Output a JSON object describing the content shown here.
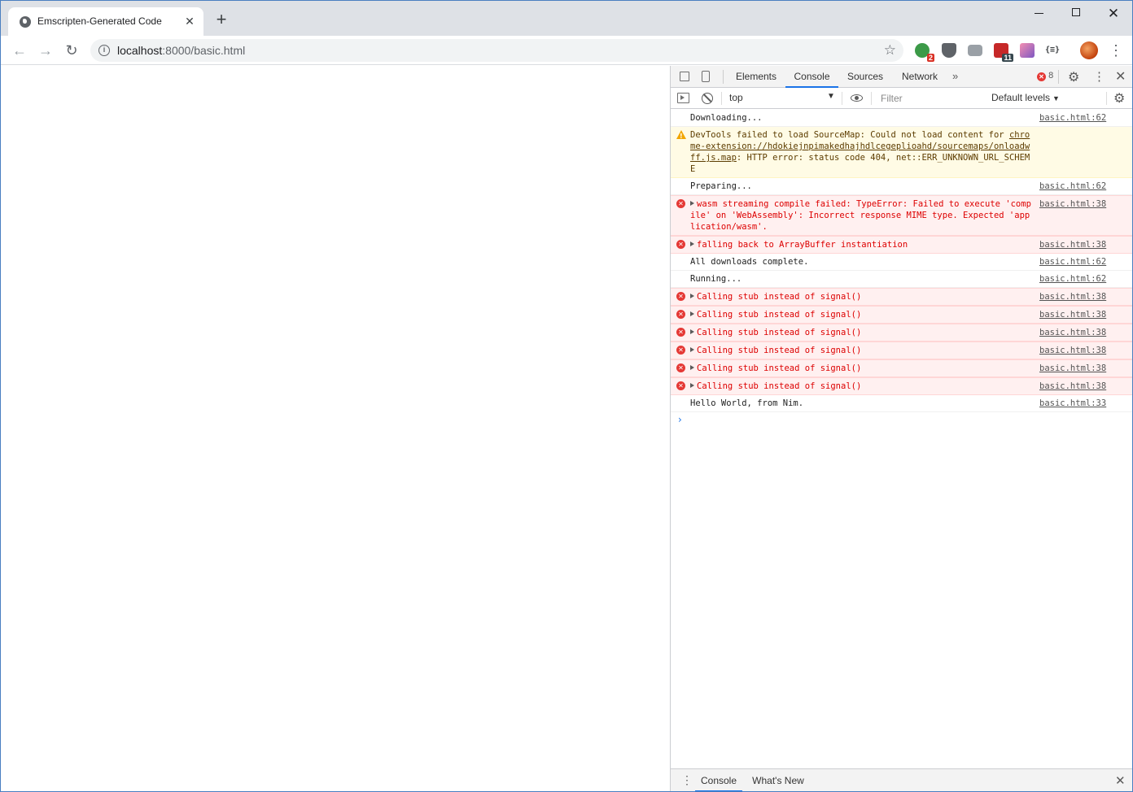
{
  "browser": {
    "tab_title": "Emscripten-Generated Code",
    "tab_close": "✕",
    "new_tab": "+",
    "url_host": "localhost",
    "url_path": ":8000/basic.html",
    "extensions": [
      {
        "name": "ext-green",
        "badge": "2"
      },
      {
        "name": "ext-shield",
        "badge": ""
      },
      {
        "name": "ext-camera",
        "badge": ""
      },
      {
        "name": "ext-calendar",
        "badge": "11"
      },
      {
        "name": "ext-gradient",
        "badge": ""
      },
      {
        "name": "ext-json",
        "label": "{≡}"
      }
    ]
  },
  "devtools": {
    "tabs": [
      "Elements",
      "Console",
      "Sources",
      "Network"
    ],
    "active_tab": "Console",
    "more": "»",
    "error_count": "8",
    "context": "top",
    "filter_placeholder": "Filter",
    "levels": "Default levels",
    "drawer_tabs": [
      "Console",
      "What's New"
    ]
  },
  "console": {
    "messages": [
      {
        "level": "log",
        "text": "Downloading...",
        "source": "basic.html:62"
      },
      {
        "level": "warning",
        "text_before": "DevTools failed to load SourceMap: Could not load content for ",
        "link": "chrome-extension://hdokiejnpimakedhajhdlcegeplioahd/sourcemaps/onloadwff.js.map",
        "text_after": ": HTTP error: status code 404, net::ERR_UNKNOWN_URL_SCHEME",
        "source": ""
      },
      {
        "level": "log",
        "text": "Preparing...",
        "source": "basic.html:62"
      },
      {
        "level": "error",
        "text": "wasm streaming compile failed: TypeError: Failed to execute 'compile' on 'WebAssembly': Incorrect response MIME type. Expected 'application/wasm'.",
        "source": "basic.html:38",
        "expandable": true
      },
      {
        "level": "error",
        "text": "falling back to ArrayBuffer instantiation",
        "source": "basic.html:38",
        "expandable": true
      },
      {
        "level": "log",
        "text": "All downloads complete.",
        "source": "basic.html:62"
      },
      {
        "level": "log",
        "text": "Running...",
        "source": "basic.html:62"
      },
      {
        "level": "error",
        "text": "Calling stub instead of signal()",
        "source": "basic.html:38",
        "expandable": true
      },
      {
        "level": "error",
        "text": "Calling stub instead of signal()",
        "source": "basic.html:38",
        "expandable": true
      },
      {
        "level": "error",
        "text": "Calling stub instead of signal()",
        "source": "basic.html:38",
        "expandable": true
      },
      {
        "level": "error",
        "text": "Calling stub instead of signal()",
        "source": "basic.html:38",
        "expandable": true
      },
      {
        "level": "error",
        "text": "Calling stub instead of signal()",
        "source": "basic.html:38",
        "expandable": true
      },
      {
        "level": "error",
        "text": "Calling stub instead of signal()",
        "source": "basic.html:38",
        "expandable": true
      },
      {
        "level": "log",
        "text": "Hello World, from Nim.",
        "source": "basic.html:33"
      }
    ]
  },
  "colors": {
    "accent": "#1a73e8",
    "error": "#e53935",
    "warning": "#f2a600",
    "error_bg": "#fff0f0",
    "warning_bg": "#fffbe5"
  }
}
